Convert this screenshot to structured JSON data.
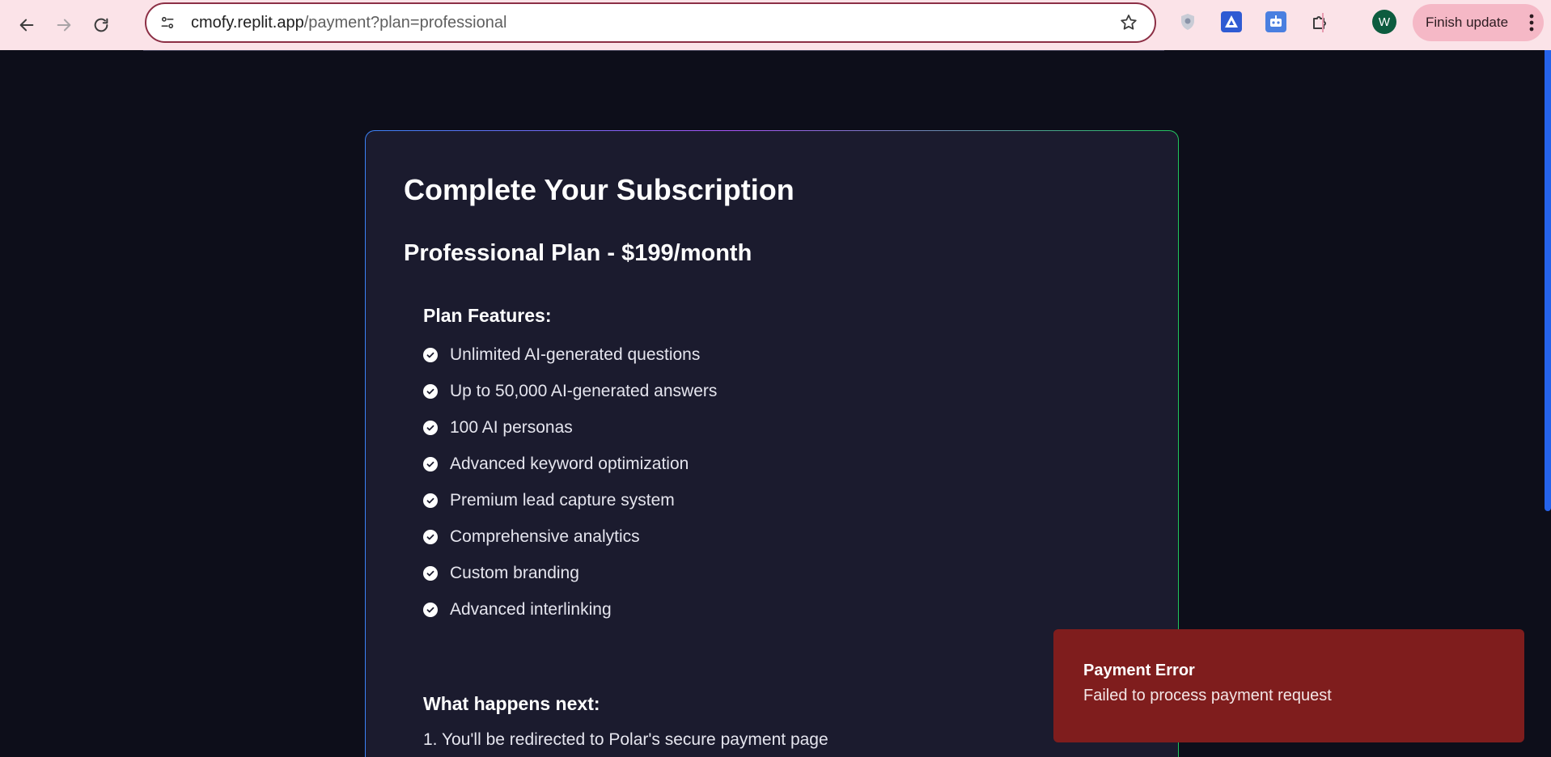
{
  "browser": {
    "url_host": "cmofy.replit.app",
    "url_path": "/payment?plan=professional",
    "avatar_letter": "W",
    "finish_update_label": "Finish update"
  },
  "page": {
    "title": "Complete Your Subscription",
    "plan_title": "Professional Plan - $199/month",
    "features_heading": "Plan Features:",
    "features": [
      "Unlimited AI-generated questions",
      "Up to 50,000 AI-generated answers",
      "100 AI personas",
      "Advanced keyword optimization",
      "Premium lead capture system",
      "Comprehensive analytics",
      "Custom branding",
      "Advanced interlinking"
    ],
    "next_heading": "What happens next:",
    "next_steps": [
      "1. You'll be redirected to Polar's secure payment page"
    ]
  },
  "toast": {
    "title": "Payment Error",
    "message": "Failed to process payment request"
  },
  "colors": {
    "chrome_bg": "#fbe3e8",
    "page_bg": "#0d0e1a",
    "card_bg": "#1b1b2e",
    "toast_bg": "#7f1d1d",
    "scrollbar": "#2563eb"
  }
}
